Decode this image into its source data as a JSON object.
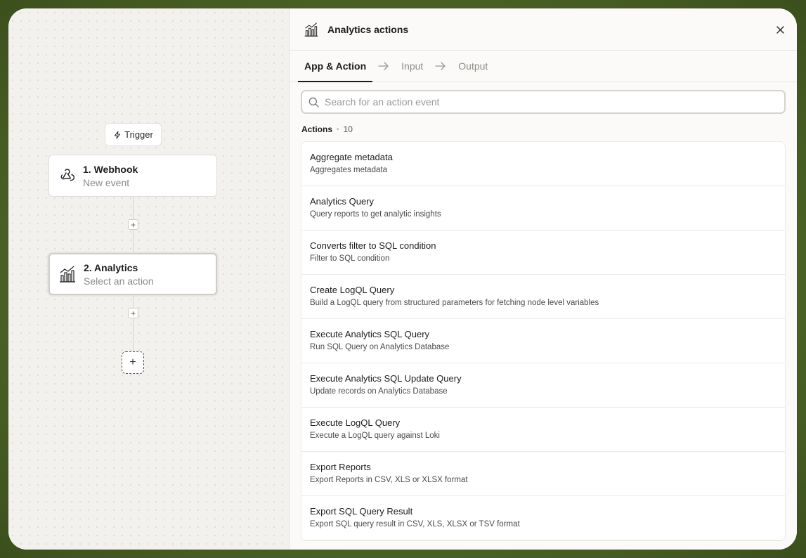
{
  "canvas": {
    "trigger_label": "Trigger",
    "nodes": [
      {
        "title": "1. Webhook",
        "subtitle": "New event"
      },
      {
        "title": "2. Analytics",
        "subtitle": "Select an action"
      }
    ],
    "plus_glyph": "+"
  },
  "panel": {
    "title": "Analytics actions",
    "tabs": [
      {
        "label": "App & Action"
      },
      {
        "label": "Input"
      },
      {
        "label": "Output"
      }
    ],
    "search": {
      "placeholder": "Search for an action event",
      "value": ""
    },
    "actions_label": "Actions",
    "actions_count": "10",
    "items": [
      {
        "title": "Aggregate metadata",
        "desc": "Aggregates metadata"
      },
      {
        "title": "Analytics Query",
        "desc": "Query reports to get analytic insights"
      },
      {
        "title": "Converts filter to SQL condition",
        "desc": "Filter to SQL condition"
      },
      {
        "title": "Create LogQL Query",
        "desc": "Build a LogQL query from structured parameters for fetching node level variables"
      },
      {
        "title": "Execute Analytics SQL Query",
        "desc": "Run SQL Query on Analytics Database"
      },
      {
        "title": "Execute Analytics SQL Update Query",
        "desc": "Update records on Analytics Database"
      },
      {
        "title": "Execute LogQL Query",
        "desc": "Execute a LogQL query against Loki"
      },
      {
        "title": "Export Reports",
        "desc": "Export Reports in CSV, XLS or XLSX format"
      },
      {
        "title": "Export SQL Query Result",
        "desc": "Export SQL query result in CSV, XLS, XLSX or TSV format"
      }
    ]
  },
  "icons": {
    "trigger": "lightning-icon",
    "webhook": "webhook-icon",
    "analytics": "bar-chart-icon",
    "close": "close-icon",
    "search": "search-icon",
    "arrow": "arrow-right-icon"
  }
}
